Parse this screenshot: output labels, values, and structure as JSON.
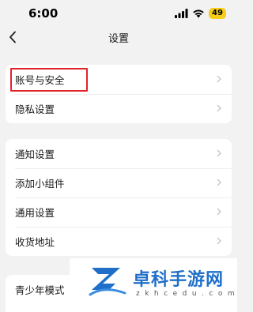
{
  "status_bar": {
    "time": "6:00",
    "battery": "49"
  },
  "header": {
    "title": "设置"
  },
  "groups": [
    [
      "账号与安全",
      "隐私设置"
    ],
    [
      "通知设置",
      "添加小组件",
      "通用设置",
      "收货地址"
    ],
    [
      "青少年模式"
    ]
  ],
  "watermark": {
    "title": "卓科手游网",
    "url": "zkhcedu.com"
  },
  "colors": {
    "highlight": "#e0242b",
    "watermark_blue": "#1f6fc9",
    "battery": "#f5cd19"
  }
}
